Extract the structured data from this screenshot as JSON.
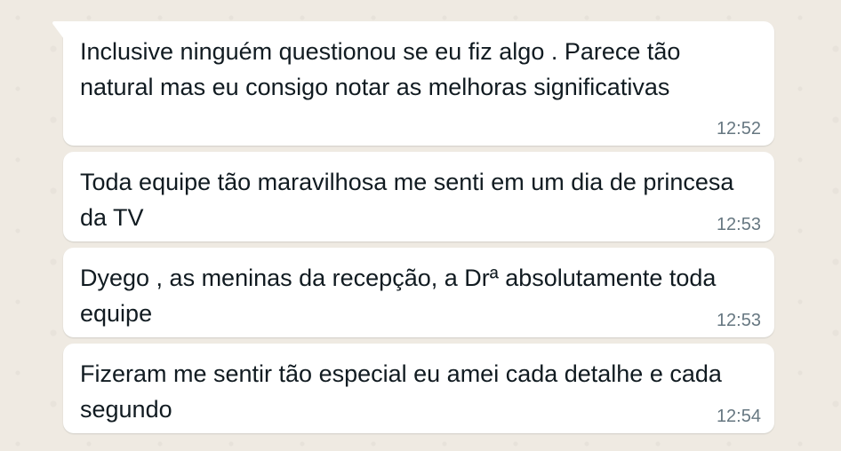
{
  "messages": [
    {
      "text": "Inclusive ninguém questionou se eu fiz algo . Parece tão natural mas eu consigo notar as melhoras significativas",
      "time": "12:52"
    },
    {
      "text": "Toda equipe tão maravilhosa me senti em um dia de princesa da TV",
      "time": "12:53"
    },
    {
      "text": "Dyego , as meninas da recepção, a Drª absolutamente toda equipe",
      "time": "12:53"
    },
    {
      "text": "Fizeram me sentir tão especial eu amei cada detalhe e cada segundo",
      "time": "12:54"
    }
  ],
  "colors": {
    "background": "#efeae2",
    "bubble": "#ffffff",
    "text": "#111b21",
    "timestamp": "#667781"
  }
}
